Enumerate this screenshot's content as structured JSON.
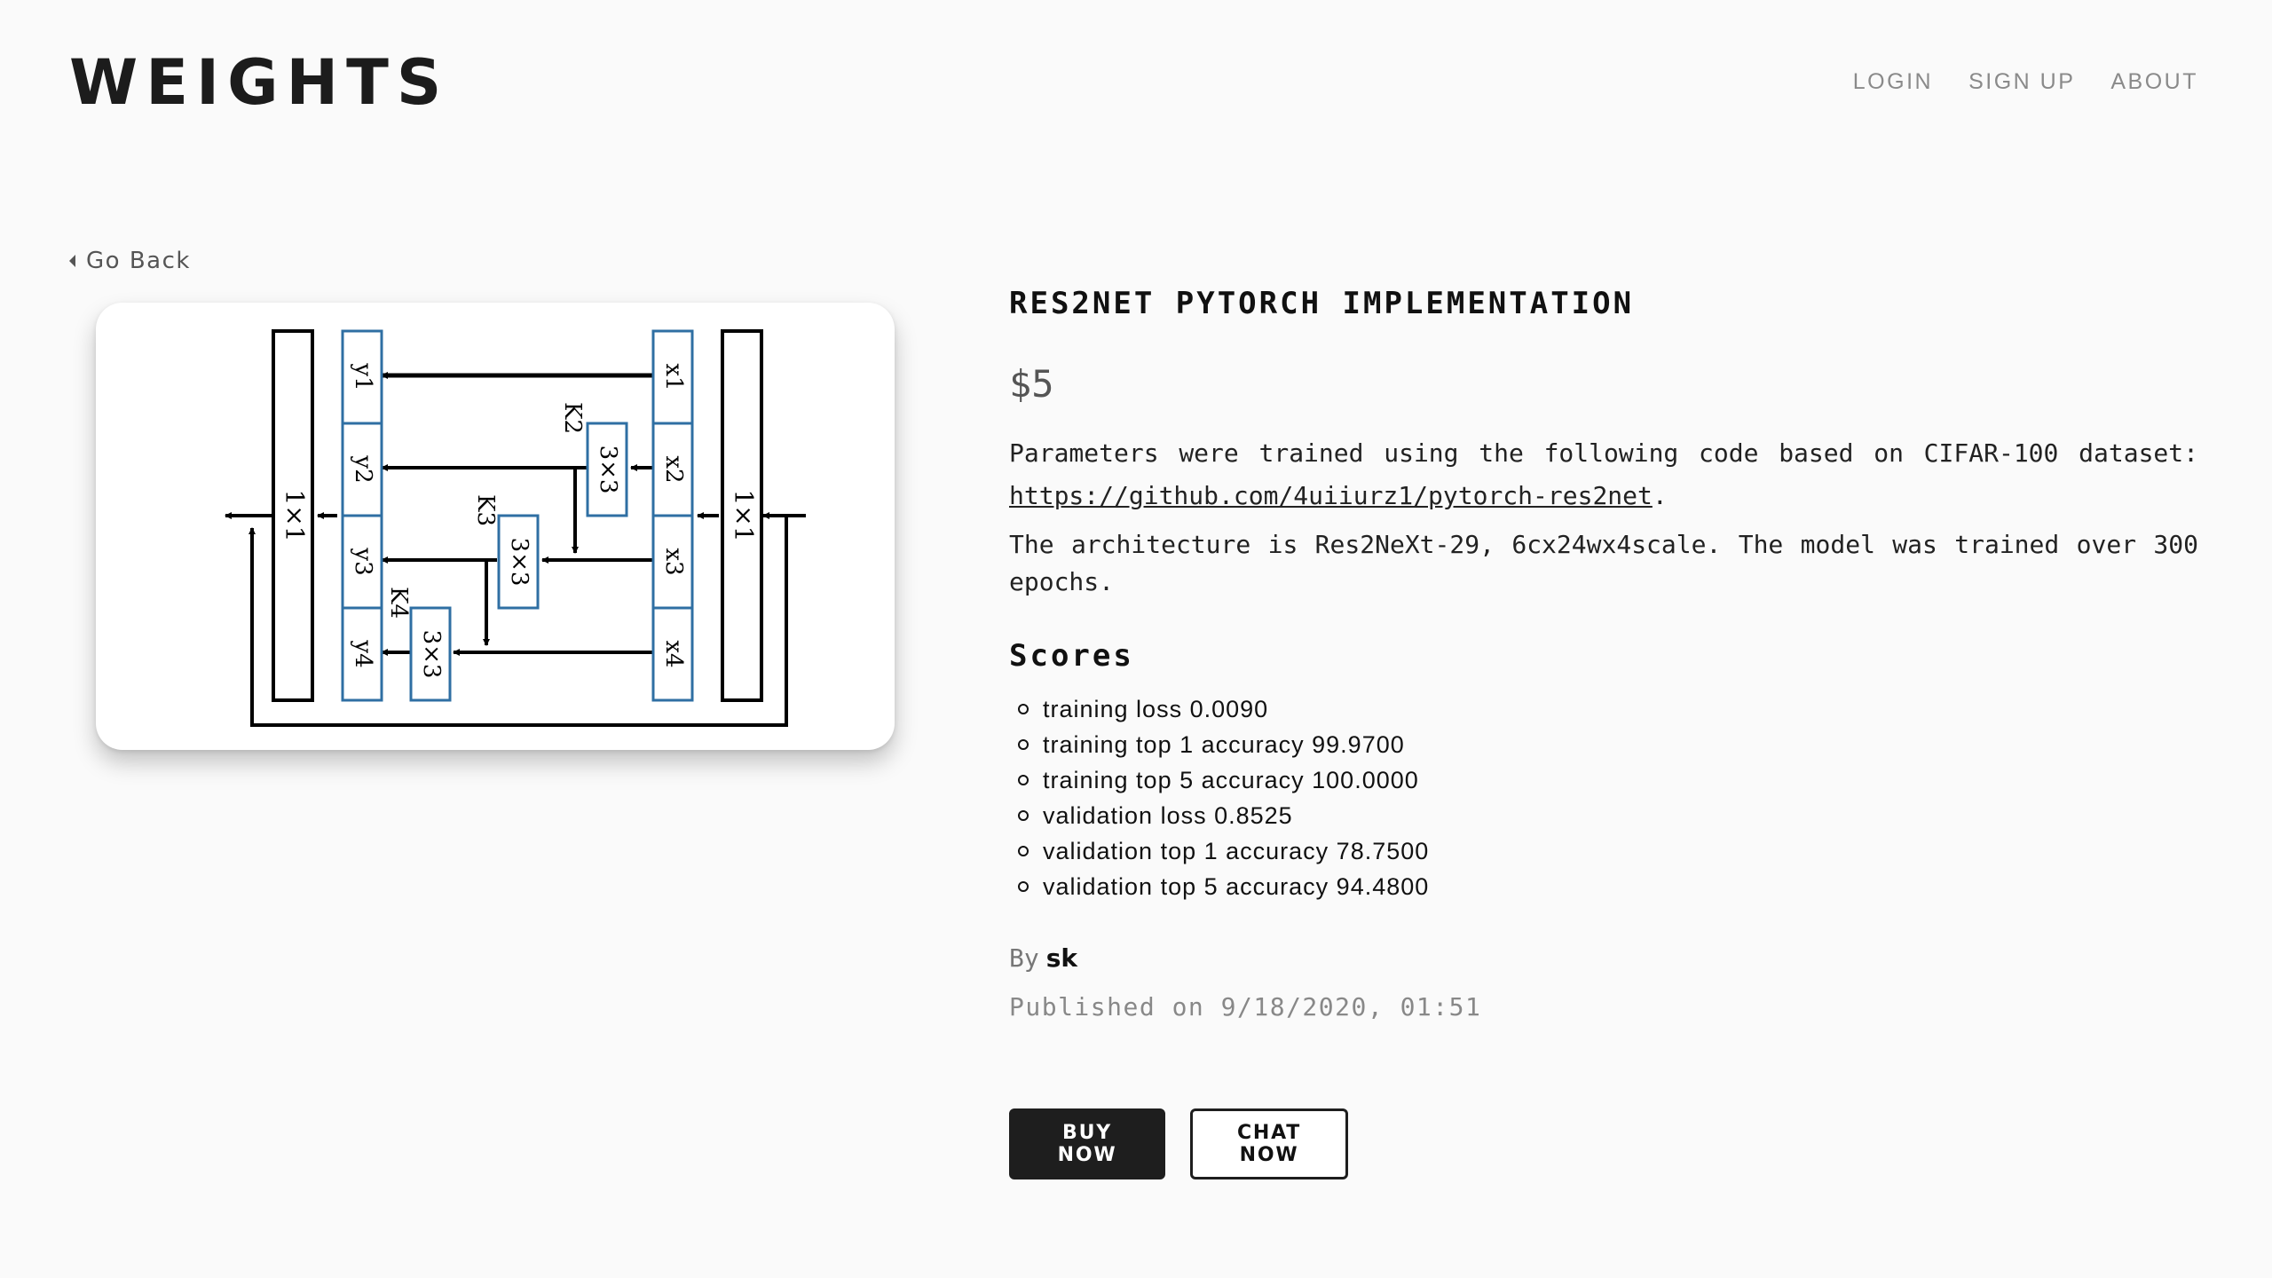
{
  "header": {
    "logo": "WEIGHTS",
    "nav": [
      {
        "label": "LOGIN"
      },
      {
        "label": "SIGN UP"
      },
      {
        "label": "ABOUT"
      }
    ]
  },
  "back": {
    "label": "Go Back"
  },
  "product": {
    "title": "RES2NET PYTORCH IMPLEMENTATION",
    "price": "$5",
    "desc1_prefix": "Parameters were trained using the following code based on CIFAR-100 dataset: ",
    "desc1_link": "https://github.com/4uiiurz1/pytorch-res2net",
    "desc1_suffix": ".",
    "desc2": "The architecture is Res2NeXt-29, 6cx24wx4scale. The model was trained over 300 epochs.",
    "scores_title": "Scores",
    "scores": [
      "training loss 0.0090",
      "training top 1 accuracy 99.9700",
      "training top 5 accuracy 100.0000",
      "validation loss 0.8525",
      "validation top 1 accuracy 78.7500",
      "validation top 5 accuracy 94.4800"
    ],
    "by_label": "By",
    "author": "sk",
    "published": "Published on 9/18/2020, 01:51"
  },
  "diagram": {
    "x_labels": [
      "x1",
      "x2",
      "x3",
      "x4"
    ],
    "y_labels": [
      "y1",
      "y2",
      "y3",
      "y4"
    ],
    "k_labels": [
      "K2",
      "K3",
      "K4"
    ],
    "conv_label": "3×3",
    "pointwise_label": "1×1",
    "block_color": "#2f6fa3"
  },
  "actions": {
    "buy": "BUY NOW",
    "chat": "CHAT NOW"
  }
}
